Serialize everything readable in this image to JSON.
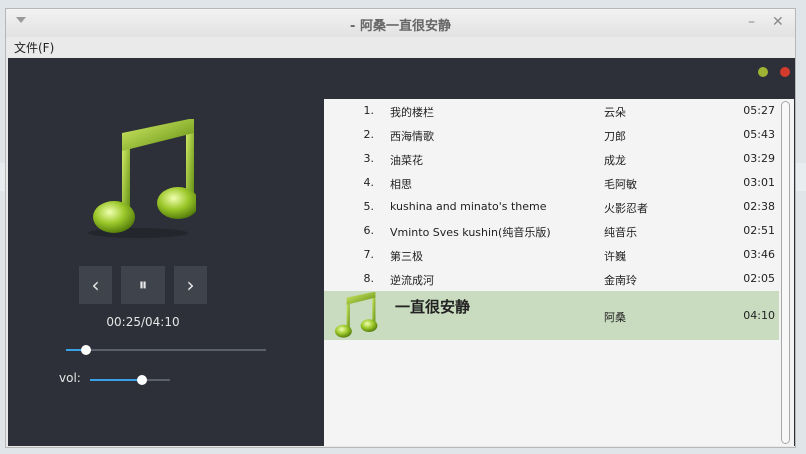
{
  "window": {
    "title": "- 阿桑一直很安静",
    "minimize_label": "–",
    "close_label": "✕"
  },
  "menu": {
    "file": "文件(F)"
  },
  "player": {
    "prev_label": "‹",
    "pause_label": "⏸",
    "next_label": "›",
    "time": "00:25/04:10",
    "progress_fraction": 0.1,
    "vol_label": "vol:",
    "volume_fraction": 0.65
  },
  "status_dots": {
    "first_color": "#9fb334",
    "second_color": "#d33b2d"
  },
  "playlist": {
    "items": [
      {
        "num": "1.",
        "title": "我的楼栏",
        "artist": "云朵",
        "duration": "05:27"
      },
      {
        "num": "2.",
        "title": "西海情歌",
        "artist": "刀郎",
        "duration": "05:43"
      },
      {
        "num": "3.",
        "title": "油菜花",
        "artist": "成龙",
        "duration": "03:29"
      },
      {
        "num": "4.",
        "title": "相思",
        "artist": "毛阿敏",
        "duration": "03:01"
      },
      {
        "num": "5.",
        "title": "kushina and minato's theme",
        "artist": "火影忍者",
        "duration": "02:38"
      },
      {
        "num": "6.",
        "title": "Vminto Sves kushin(纯音乐版)",
        "artist": "纯音乐",
        "duration": "02:51"
      },
      {
        "num": "7.",
        "title": "第三极",
        "artist": "许巍",
        "duration": "03:46"
      },
      {
        "num": "8.",
        "title": "逆流成河",
        "artist": "金南玲",
        "duration": "02:05"
      }
    ],
    "current": {
      "title": "一直很安静",
      "artist": "阿桑",
      "duration": "04:10"
    }
  }
}
